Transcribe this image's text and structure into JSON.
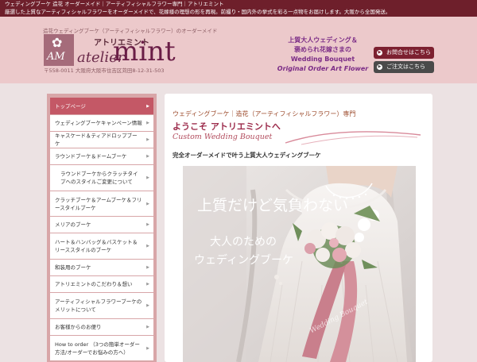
{
  "topbar": {
    "line1": "ウェディングブーケ 造花 オーダーメイド｜アーティフィシャルフラワー専門｜アトリエミント",
    "line2": "厳選した上質なアーティフィシャルフラワーをオーダーメイドで、花嫁様の理想の形を再現。前撮り・国内外の挙式を彩る一点物をお届けします。大阪から全国発送。"
  },
  "header": {
    "tagline": "造花ウェディングブーケ（アーティフィシャルフラワー）のオーダーメイド",
    "logo": {
      "mark": "AM",
      "kana": "アトリエミント",
      "word1": "atelier",
      "word2": "mint"
    },
    "address": "〒558-0011 大阪府大阪市住吉区苅田8-12-31-503",
    "promo": {
      "line1": "上質大人ウェディング＆",
      "line2": "褒められ花嫁さまの",
      "line3": "Wedding Bouquet",
      "line4": "Original Order Art Flower"
    },
    "contact_button": "お問合せはこちら",
    "order_button": "ご注文はこちら"
  },
  "sidebar": {
    "items": [
      {
        "label": "トップページ",
        "active": true
      },
      {
        "label": "ウェディングブーケキャンペーン情報"
      },
      {
        "label": "キャスケード＆ティアドロップブーケ"
      },
      {
        "label": "ラウンドブーケ＆ドームブーケ"
      },
      {
        "label": "ラウンドブーケからクラッチタイプへのスタイルご変更について",
        "sub": true
      },
      {
        "label": "クラッチブーケ＆アームブーケ＆フリースタイルブーケ"
      },
      {
        "label": "メリアのブーケ"
      },
      {
        "label": "ハート＆ハンバッグ＆バスケット＆リーススタイルのブーケ"
      },
      {
        "label": "和装用のブーケ"
      },
      {
        "label": "アトリエミントのこだわり＆想い"
      },
      {
        "label": "アーティフィシャルフラワーブーケのメリットについて"
      },
      {
        "label": "お客様からのお便り"
      },
      {
        "label": "How to order （3つの簡単オーダー方法/オーダーでお悩みの方へ）"
      }
    ]
  },
  "main": {
    "subtitle": "ウェディングブーケ｜造花（アーティフィシャルフラワー）専門",
    "title": "ようこそ アトリエミントへ",
    "title_en": "Custom Wedding Bouquet",
    "lead": "完全オーダーメイドで叶う上質大人ウェディングブーケ",
    "hero": {
      "line1": "上質だけど気負わない",
      "line2": "大人のための",
      "line3": "ウェディングブーケ",
      "watermark": "Wedding Bouquet"
    }
  },
  "colors": {
    "topbar": "#6e1f2b",
    "header_bg": "#ecc9cb",
    "sidebar_bg": "#d8a6a8",
    "sidebar_active": "#c45866",
    "accent": "#9c2b4b"
  }
}
